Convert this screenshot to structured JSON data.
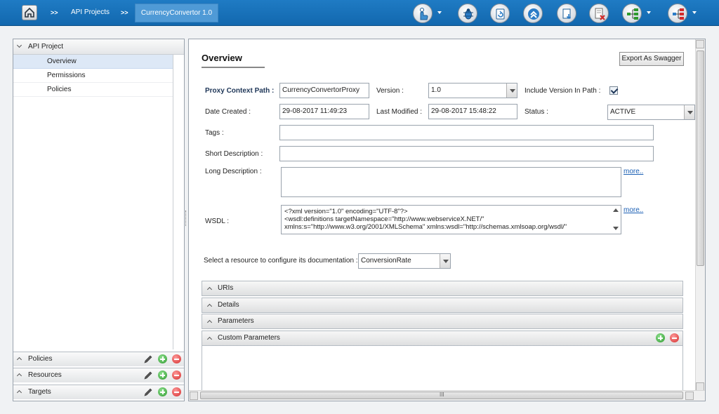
{
  "topbar": {
    "separator": ">>",
    "breadcrumb": [
      "API Projects"
    ],
    "active_crumb": "CurrencyConvertor 1.0",
    "tools": [
      "touch-config-icon",
      "debug-bug-icon",
      "refresh-icon",
      "publish-up-icon",
      "download-icon",
      "delete-document-icon",
      "tree-green-icon",
      "tree-red-icon"
    ]
  },
  "left": {
    "header": "API Project",
    "items": [
      "Overview",
      "Permissions",
      "Policies"
    ],
    "sections": [
      "Policies",
      "Resources",
      "Targets"
    ]
  },
  "main": {
    "title": "Overview",
    "export_label": "Export As Swagger",
    "proxy_context_path_label": "Proxy Context Path :",
    "proxy_context_path": "CurrencyConvertorProxy",
    "version_label": "Version :",
    "version": "1.0",
    "include_version_label": "Include Version In Path :",
    "include_version_checked": true,
    "date_created_label": "Date Created :",
    "date_created": "29-08-2017 11:49:23",
    "last_modified_label": "Last Modified :",
    "last_modified": "29-08-2017 15:48:22",
    "status_label": "Status :",
    "status": "ACTIVE",
    "tags_label": "Tags :",
    "tags": "",
    "short_desc_label": "Short Description :",
    "short_desc": "",
    "long_desc_label": "Long Description :",
    "long_desc": "",
    "more": "more..",
    "wsdl_label": "WSDL :",
    "wsdl_lines": [
      "<?xml version=\"1.0\" encoding=\"UTF-8\"?>",
      "<wsdl:definitions targetNamespace=\"http://www.webserviceX.NET/\"",
      "xmlns:s=\"http://www.w3.org/2001/XMLSchema\" xmlns:wsdl=\"http://schemas.xmlsoap.org/wsdl/\""
    ],
    "resource_label": "Select a resource to configure its documentation :",
    "resource": "ConversionRate",
    "sections": [
      "URIs",
      "Details",
      "Parameters",
      "Custom Parameters"
    ],
    "hscroll_grip": "III"
  }
}
